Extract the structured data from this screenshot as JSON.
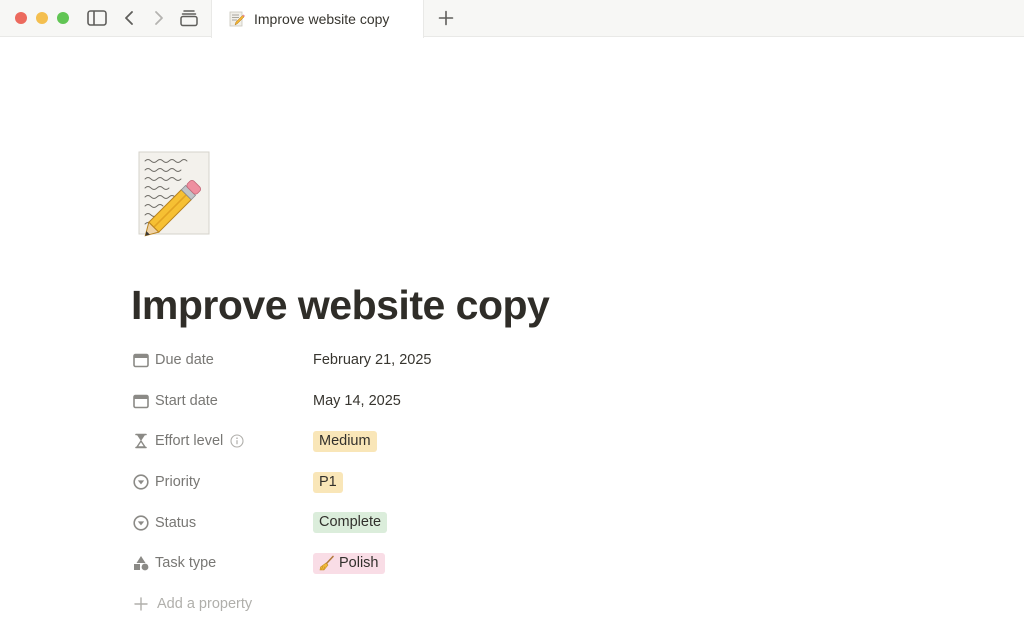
{
  "tab": {
    "title": "Improve website copy",
    "emoji": "memo-icon"
  },
  "page": {
    "title": "Improve website copy",
    "icon": "memo-pencil-icon"
  },
  "properties": [
    {
      "name": "Due date",
      "icon": "calendar-icon",
      "value": "February 21, 2025",
      "kind": "text"
    },
    {
      "name": "Start date",
      "icon": "calendar-icon",
      "value": "May 14, 2025",
      "kind": "text"
    },
    {
      "name": "Effort level",
      "icon": "hourglass-icon",
      "value": "Medium",
      "kind": "tag",
      "color": "#f9e6b8"
    },
    {
      "name": "Priority",
      "icon": "select-circle-icon",
      "value": "P1",
      "kind": "tag",
      "color": "#f9e6b8"
    },
    {
      "name": "Status",
      "icon": "select-circle-icon",
      "value": "Complete",
      "kind": "tag",
      "color": "#dbeddb"
    },
    {
      "name": "Task type",
      "icon": "shapes-icon",
      "value": "Polish",
      "kind": "tag",
      "color": "#f9dde6"
    }
  ],
  "add_property_label": "Add a property",
  "colors": {
    "titlebar_bg": "#f7f7f5",
    "close": "#ec6a5e",
    "minimize": "#f4bf4f",
    "zoom": "#61c554"
  }
}
